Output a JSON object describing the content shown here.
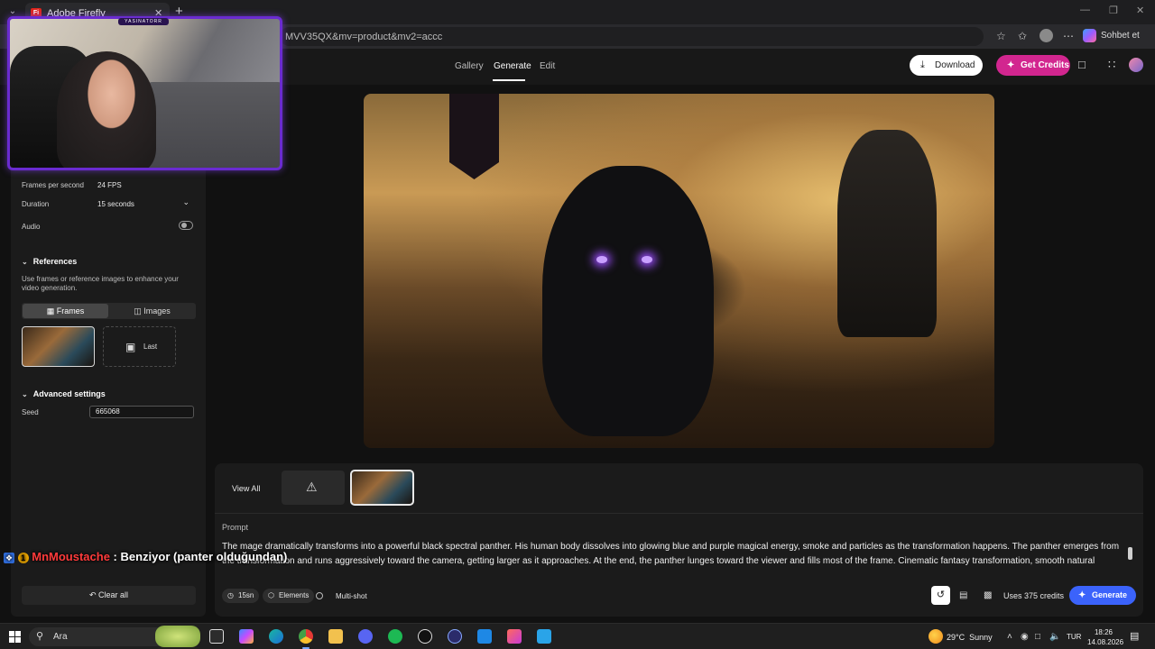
{
  "browser": {
    "tab_title": "Adobe Firefly",
    "tab_icon": "adobe-firefly-icon",
    "url": "MVV35QX&mv=product&mv2=accc",
    "sohbet_label": "Sohbet et"
  },
  "header": {
    "nav": [
      "Gallery",
      "Generate",
      "Edit"
    ],
    "active_nav": "Generate",
    "download_label": "Download",
    "get_credits_label": "Get Credits"
  },
  "settings": {
    "fps_label": "Frames per second",
    "fps_value": "24 FPS",
    "duration_label": "Duration",
    "duration_value": "15 seconds",
    "audio_label": "Audio",
    "audio_enabled": false
  },
  "references": {
    "title": "References",
    "description": "Use frames or reference images to enhance your video generation.",
    "tabs": [
      "Frames",
      "Images"
    ],
    "active_tab": "Frames",
    "last_label": "Last"
  },
  "advanced": {
    "title": "Advanced settings",
    "seed_label": "Seed",
    "seed_value": "665068"
  },
  "clear_all_label": "Clear all",
  "webcam": {
    "badge": "YASINATORR"
  },
  "results": {
    "view_all_label": "View All"
  },
  "prompt": {
    "label": "Prompt",
    "text": "The mage dramatically transforms into a powerful black spectral panther. His human body dissolves into glowing blue and purple magical energy, smoke and particles as the transformation happens. The panther emerges from the transformation and runs aggressively toward the camera, getting larger as it approaches. At the end, the panther lunges toward the viewer and fills most of the frame. Cinematic fantasy transformation, smooth natural motion, intense"
  },
  "controls": {
    "duration_chip": "15sn",
    "elements_chip": "Elements",
    "multishot_label": "Multi-shot",
    "uses_credits": "Uses 375 credits",
    "generate_label": "Generate"
  },
  "chat": {
    "badge_num": "1",
    "user": "MnMoustache",
    "separator": " : ",
    "message": "Benziyor (panter olduğundan)"
  },
  "taskbar": {
    "search_placeholder": "Ara",
    "weather_temp": "29°C",
    "weather_cond": "Sunny",
    "lang": "TUR",
    "time": "18:26",
    "date": "14.08.2026"
  },
  "colors": {
    "accent_blue": "#3b63fb",
    "credits_pink": "#d2268f",
    "webcam_border": "#6a2bd0"
  }
}
